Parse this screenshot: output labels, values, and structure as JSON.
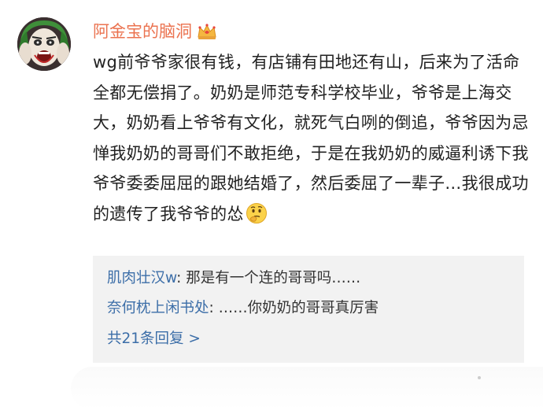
{
  "comment": {
    "author": "阿金宝的脑洞",
    "badge_icon": "crown-icon",
    "text": "wg前爷爷家很有钱，有店铺有田地还有山，后来为了活命全都无偿捐了。奶奶是师范专科学校毕业，爷爷是上海交大，奶奶看上爷爷有文化，就死气白咧的倒追，爷爷因为忌惮我奶奶的哥哥们不敢拒绝，于是在我奶奶的威逼利诱下我爷爷委委屈屈的跟她结婚了，然后委屈了一辈子…我很成功的遗传了我爷爷的怂",
    "trailing_emoji": "thinking-face-icon"
  },
  "replies": [
    {
      "author": "肌肉壮汉w",
      "text": ": 那是有一个连的哥哥吗……"
    },
    {
      "author": "奈何枕上闲书处",
      "text": ": ……你奶奶的哥哥真厉害"
    }
  ],
  "more_replies_label": "共21条回复 >",
  "colors": {
    "username": "#eb7350",
    "link": "#3c6ea8",
    "reply_background": "#f2f2f2",
    "text": "#222222"
  }
}
